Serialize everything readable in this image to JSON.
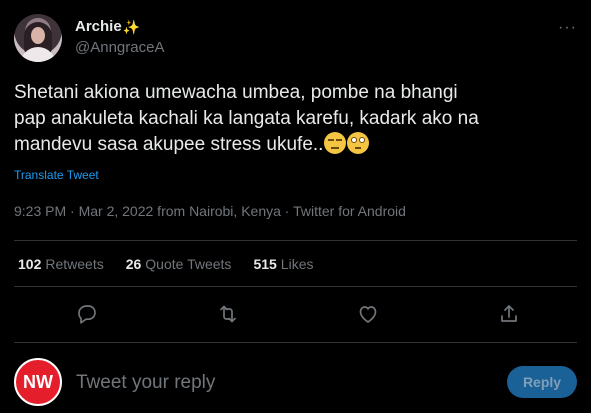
{
  "author": {
    "display_name": "Archie",
    "badge_emoji": "✨",
    "handle": "@AnngraceA",
    "avatar_icon": "profile-photo"
  },
  "more_icon": "···",
  "tweet": {
    "line1": "Shetani akiona umewacha umbea, pombe na bhangi",
    "line2": "pap anakuleta kachali ka langata karefu, kadark ako na",
    "line3": "mandevu sasa akupee stress ukufe..",
    "emojis": [
      "unamused-face-icon",
      "face-with-rolling-eyes-icon"
    ],
    "translate_label": "Translate Tweet",
    "meta": "9:23 PM · Mar 2, 2022 from Nairobi, Kenya · Twitter for Android"
  },
  "stats": {
    "retweets_count": "102",
    "retweets_label": "Retweets",
    "quotes_count": "26",
    "quotes_label": "Quote Tweets",
    "likes_count": "515",
    "likes_label": "Likes"
  },
  "actions": [
    "reply-icon",
    "retweet-icon",
    "like-icon",
    "share-icon"
  ],
  "reply_box": {
    "avatar_text": "NW",
    "placeholder": "Tweet your reply",
    "button_label": "Reply"
  },
  "colors": {
    "background": "#000000",
    "accent": "#1d9bf0",
    "muted": "#71767b",
    "reply_button": "#1a6197",
    "nw_badge": "#e41e2b"
  }
}
